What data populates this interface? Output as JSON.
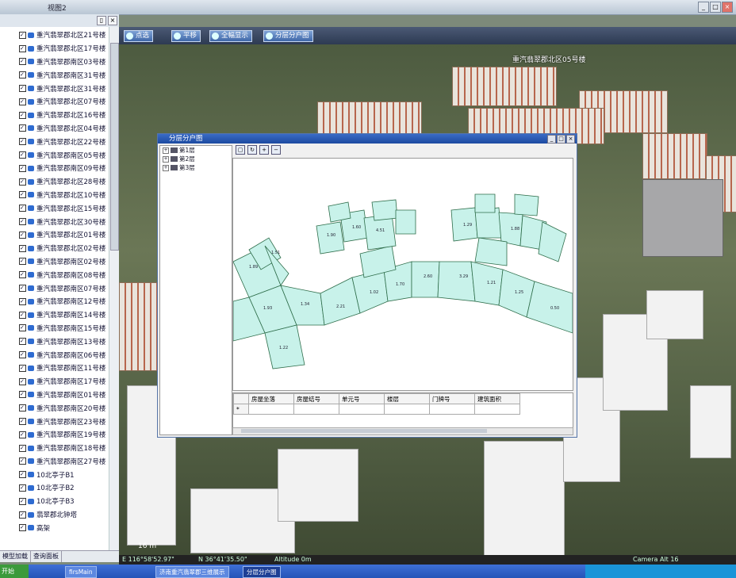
{
  "window": {
    "title": "视图2"
  },
  "toolbar": {
    "buttons": [
      {
        "label": "点选"
      },
      {
        "label": "平移"
      },
      {
        "label": "全幅显示"
      },
      {
        "label": "分层分户图"
      }
    ]
  },
  "sidebar": {
    "items": [
      "重汽翡翠郡北区21号楼",
      "重汽翡翠郡北区17号楼",
      "重汽翡翠郡南区03号楼",
      "重汽翡翠郡南区31号楼",
      "重汽翡翠郡北区31号楼",
      "重汽翡翠郡北区07号楼",
      "重汽翡翠郡北区16号楼",
      "重汽翡翠郡北区04号楼",
      "重汽翡翠郡北区22号楼",
      "重汽翡翠郡南区05号楼",
      "重汽翡翠郡南区09号楼",
      "重汽翡翠郡北区28号楼",
      "重汽翡翠郡北区10号楼",
      "重汽翡翠郡北区15号楼",
      "重汽翡翠郡北区30号楼",
      "重汽翡翠郡北区01号楼",
      "重汽翡翠郡北区02号楼",
      "重汽翡翠郡南区02号楼",
      "重汽翡翠郡南区08号楼",
      "重汽翡翠郡南区07号楼",
      "重汽翡翠郡南区12号楼",
      "重汽翡翠郡南区14号楼",
      "重汽翡翠郡南区15号楼",
      "重汽翡翠郡南区13号楼",
      "重汽翡翠郡南区06号楼",
      "重汽翡翠郡南区11号楼",
      "重汽翡翠郡南区17号楼",
      "重汽翡翠郡南区01号楼",
      "重汽翡翠郡南区20号楼",
      "重汽翡翠郡南区23号楼",
      "重汽翡翠郡南区19号楼",
      "重汽翡翠郡南区18号楼",
      "重汽翡翠郡南区27号楼",
      "10北亭子B1",
      "10北亭子B2",
      "10北亭子B3",
      "翡翠郡北钟塔",
      "高架"
    ],
    "tabs": [
      "模型加载",
      "查询面板"
    ]
  },
  "scene": {
    "placemark": "重汽翡翠郡北区05号楼",
    "scale": "16 m",
    "status": {
      "lon": "E 116°58'52.97\"",
      "lat": "N 36°41'35.50\"",
      "altitude": "Altitude 0m",
      "camera": "Camera Alt 16"
    }
  },
  "dialog": {
    "title": "分层分户图",
    "floors": [
      "第1层",
      "第2层",
      "第3层"
    ],
    "map_labels": [
      "1.89",
      "1.51",
      "1.93",
      "1.22",
      "1.34",
      "2.21",
      "1.02",
      "1.70",
      "2.60",
      "1.90",
      "1.60",
      "4.51",
      "3.29",
      "1.21",
      "1.25",
      "0.50",
      "1.29",
      "1.88"
    ],
    "columns": [
      "房屋坐落",
      "房屋结号",
      "单元号",
      "楼层",
      "门牌号",
      "建筑面积"
    ]
  },
  "taskbar": {
    "start": "开始",
    "items": [
      "firsMain",
      "济南重汽翡翠郡三维展示",
      "分层分户图"
    ]
  },
  "colors": {
    "parcel_fill": "#c8f2ea",
    "parcel_stroke": "#2e6d4a",
    "title_blue": "#1c4aa0"
  }
}
